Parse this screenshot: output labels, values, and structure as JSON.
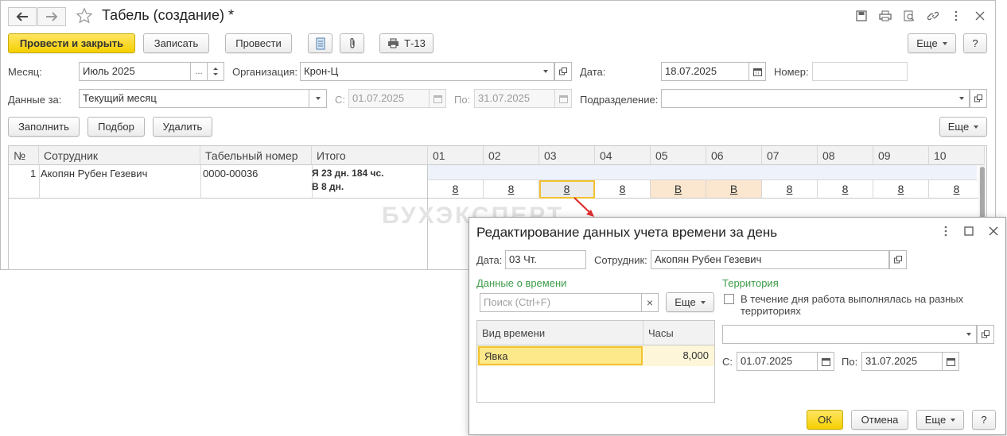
{
  "window": {
    "title": "Табель (создание) *",
    "watermark": "БУХЭКСПЕРТ"
  },
  "toolbar": {
    "post_close": "Провести и закрыть",
    "write": "Записать",
    "post": "Провести",
    "t13": "Т-13",
    "more": "Еще",
    "help": "?"
  },
  "form": {
    "month_label": "Месяц:",
    "month_value": "Июль 2025",
    "month_select": "...",
    "org_label": "Организация:",
    "org_value": "Крон-Ц",
    "date_label": "Дата:",
    "date_value": "18.07.2025",
    "number_label": "Номер:",
    "number_value": "",
    "data_for_label": "Данные за:",
    "data_for_value": "Текущий месяц",
    "from_label": "С:",
    "from_value": "01.07.2025",
    "to_label": "По:",
    "to_value": "31.07.2025",
    "dept_label": "Подразделение:",
    "dept_value": ""
  },
  "table_toolbar": {
    "fill": "Заполнить",
    "pick": "Подбор",
    "delete": "Удалить",
    "more": "Еще"
  },
  "table": {
    "headers": [
      "№",
      "Сотрудник",
      "Табельный номер",
      "Итого"
    ],
    "days": [
      "01",
      "02",
      "03",
      "04",
      "05",
      "06",
      "07",
      "08",
      "09",
      "10"
    ],
    "rows": [
      {
        "num": "1",
        "employee": "Акопян Рубен Гезевич",
        "tab_number": "0000-00036",
        "total_line1": "Я 23 дн. 184 чс.",
        "total_line2": "В 8 дн.",
        "values": [
          "8",
          "8",
          "8",
          "8",
          "В",
          "В",
          "8",
          "8",
          "8",
          "8"
        ]
      }
    ]
  },
  "dialog": {
    "title": "Редактирование данных учета времени за день",
    "date_label": "Дата:",
    "date_value": "03 Чт.",
    "employee_label": "Сотрудник:",
    "employee_value": "Акопян Рубен Гезевич",
    "time_section": "Данные о времени",
    "search_placeholder": "Поиск (Ctrl+F)",
    "search_clear": "×",
    "more": "Еще",
    "col_kind": "Вид времени",
    "col_hours": "Часы",
    "row_kind": "Явка",
    "row_hours": "8,000",
    "territory_section": "Территория",
    "territory_check": "В течение дня работа выполнялась на разных территориях",
    "territory_value": "",
    "from_label": "С:",
    "from_value": "01.07.2025",
    "to_label": "По:",
    "to_value": "31.07.2025",
    "ok": "ОК",
    "cancel": "Отмена",
    "help": "?"
  },
  "colors": {
    "primary_button": "#f5d000",
    "weekend_cell": "#fbe6cf",
    "selected_row": "#fde98a",
    "section_green": "#3d9b47",
    "arrow": "#e03030"
  }
}
